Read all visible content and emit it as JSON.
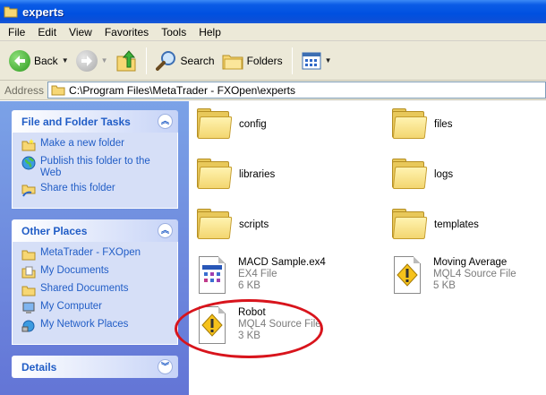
{
  "window": {
    "title": "experts"
  },
  "menu": [
    "File",
    "Edit",
    "View",
    "Favorites",
    "Tools",
    "Help"
  ],
  "toolbar": {
    "back": "Back",
    "search": "Search",
    "folders": "Folders"
  },
  "address": {
    "label": "Address",
    "path": "C:\\Program Files\\MetaTrader - FXOpen\\experts"
  },
  "tasks": {
    "title": "File and Folder Tasks",
    "items": [
      "Make a new folder",
      "Publish this folder to the Web",
      "Share this folder"
    ]
  },
  "places": {
    "title": "Other Places",
    "items": [
      "MetaTrader - FXOpen",
      "My Documents",
      "Shared Documents",
      "My Computer",
      "My Network Places"
    ]
  },
  "details": {
    "title": "Details"
  },
  "folders": [
    "config",
    "files",
    "libraries",
    "logs",
    "scripts",
    "templates"
  ],
  "files": [
    {
      "name": "MACD Sample.ex4",
      "type": "EX4 File",
      "size": "6 KB"
    },
    {
      "name": "Moving Average",
      "type": "MQL4 Source File",
      "size": "5 KB"
    },
    {
      "name": "Robot",
      "type": "MQL4 Source File",
      "size": "3 KB"
    }
  ],
  "colors": {
    "titlebar": "#0050e0",
    "taskpane": "#6f8fe0",
    "link": "#215dc6",
    "highlight": "#d8141c"
  }
}
